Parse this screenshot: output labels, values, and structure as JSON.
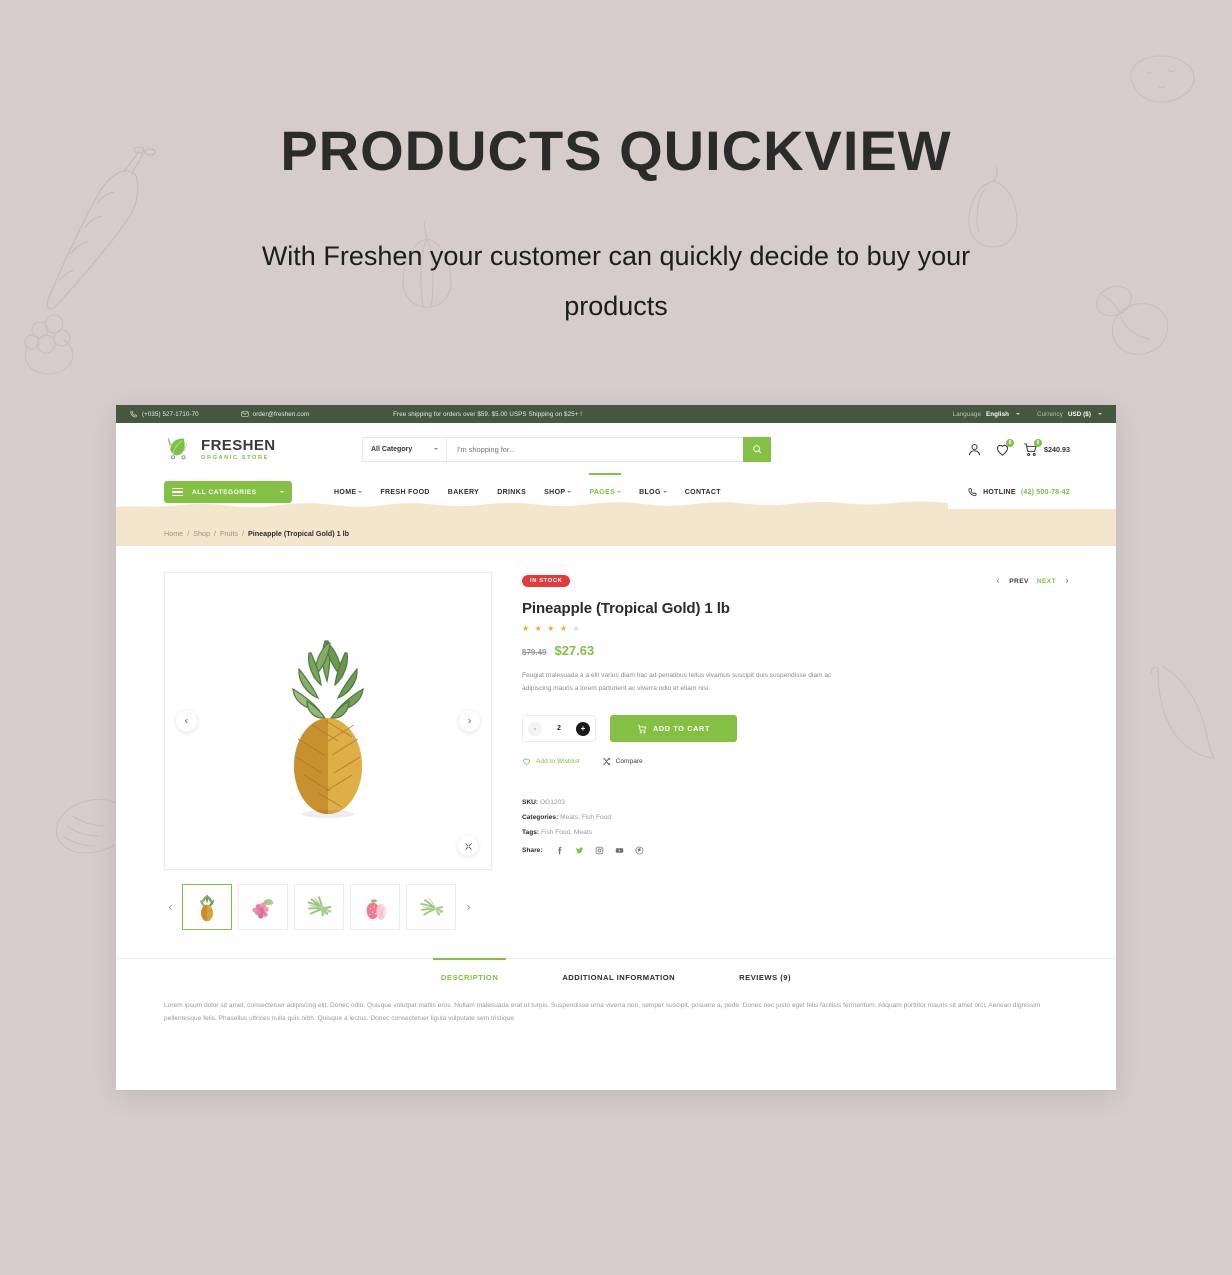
{
  "hero": {
    "title": "PRODUCTS  QUICKVIEW",
    "subtitle": "With Freshen your customer can quickly decide to buy your products"
  },
  "topbar": {
    "phone": "(+035) 527-1710-70",
    "email": "order@freshen.com",
    "shipping_note": "Free shipping for orders over $59. $5.00 USPS Shipping on $25+ !",
    "language_label": "Language",
    "language_value": "English",
    "currency_label": "Currency",
    "currency_value": "USD ($)"
  },
  "brand": {
    "name": "FRESHEN",
    "tagline": "ORGANIC STORE"
  },
  "search": {
    "category": "All Category",
    "placeholder": "I'm shopping for...",
    "value": ""
  },
  "header_actions": {
    "wishlist_count": "0",
    "cart_count": "0",
    "cart_amount": "$240.93"
  },
  "nav": {
    "all_categories": "ALL CATEGORIES",
    "items": [
      {
        "label": "HOME",
        "has_caret": true,
        "active": false
      },
      {
        "label": "FRESH FOOD",
        "has_caret": false,
        "active": false
      },
      {
        "label": "BAKERY",
        "has_caret": false,
        "active": false
      },
      {
        "label": "DRINKS",
        "has_caret": false,
        "active": false
      },
      {
        "label": "SHOP",
        "has_caret": true,
        "active": false
      },
      {
        "label": "PAGES",
        "has_caret": true,
        "active": true
      },
      {
        "label": "BLOG",
        "has_caret": true,
        "active": false
      },
      {
        "label": "CONTACT",
        "has_caret": false,
        "active": false
      }
    ],
    "hotline_label": "HOTLINE",
    "hotline_number": "(42) 500-78-42"
  },
  "breadcrumb": {
    "items": [
      "Home",
      "Shop",
      "Fruits"
    ],
    "current": "Pineapple (Tropical Gold) 1 lb"
  },
  "product": {
    "stock_badge": "IN STOCK",
    "prev_label": "PREV",
    "next_label": "NEXT",
    "title": "Pineapple (Tropical Gold) 1 lb",
    "rating": 4,
    "rating_max": 5,
    "old_price": "$79.49",
    "price": "$27.63",
    "description": "Feugiat malesuada a a elit varius diam hac ad penatibus tellus vivamus suscipit duis suspendisse diam ac adipiscing mauris a lorem parturient ac viverra odio et etiam nisi.",
    "quantity": "2",
    "qty_minus": "-",
    "qty_plus": "+",
    "add_to_cart": "ADD TO CART",
    "wishlist": "Add to Wishlist",
    "compare": "Compare",
    "sku_label": "SKU:",
    "sku": "OG1203",
    "categories_label": "Categories:",
    "categories": "Meats, Fish Food",
    "tags_label": "Tags:",
    "tags": "Fish Food, Meats",
    "share_label": "Share:",
    "share_icons": [
      "facebook-icon",
      "twitter-icon",
      "instagram-icon",
      "youtube-icon",
      "pinterest-icon"
    ],
    "thumbnails": [
      {
        "name": "pineapple",
        "active": true
      },
      {
        "name": "berries",
        "active": false
      },
      {
        "name": "green-beans",
        "active": false
      },
      {
        "name": "strawberries",
        "active": false
      },
      {
        "name": "green-vegetable",
        "active": false
      }
    ]
  },
  "tabs": {
    "items": [
      {
        "label": "DESCRIPTION",
        "active": true
      },
      {
        "label": "ADDITIONAL INFORMATION",
        "active": false
      },
      {
        "label": "REVIEWS (9)",
        "active": false
      }
    ],
    "body": "Lorem ipsum dolor sit amet, consectetuer adipiscing elit. Donec odio. Quisque volutpat mattis eros. Nullam malesuada erat ut turpis. Suspendisse urna viverra non, semper suscipit, posuere a, pede. Donec nec justo eget felis facilisis fermentum. Aliquam porttitor mauris sit amet orci. Aenean dignissim pellentesque felis. Phasellus ultrices nulla quis nibh. Quisque a lectus. Donec consectetuer ligula vulputate sem tristique"
  },
  "colors": {
    "page_background": "#d6cccc",
    "accent_green": "#84c043",
    "dark_green": "#44573f",
    "band_cream": "#f2e6cd",
    "stock_red": "#e23b3b"
  }
}
